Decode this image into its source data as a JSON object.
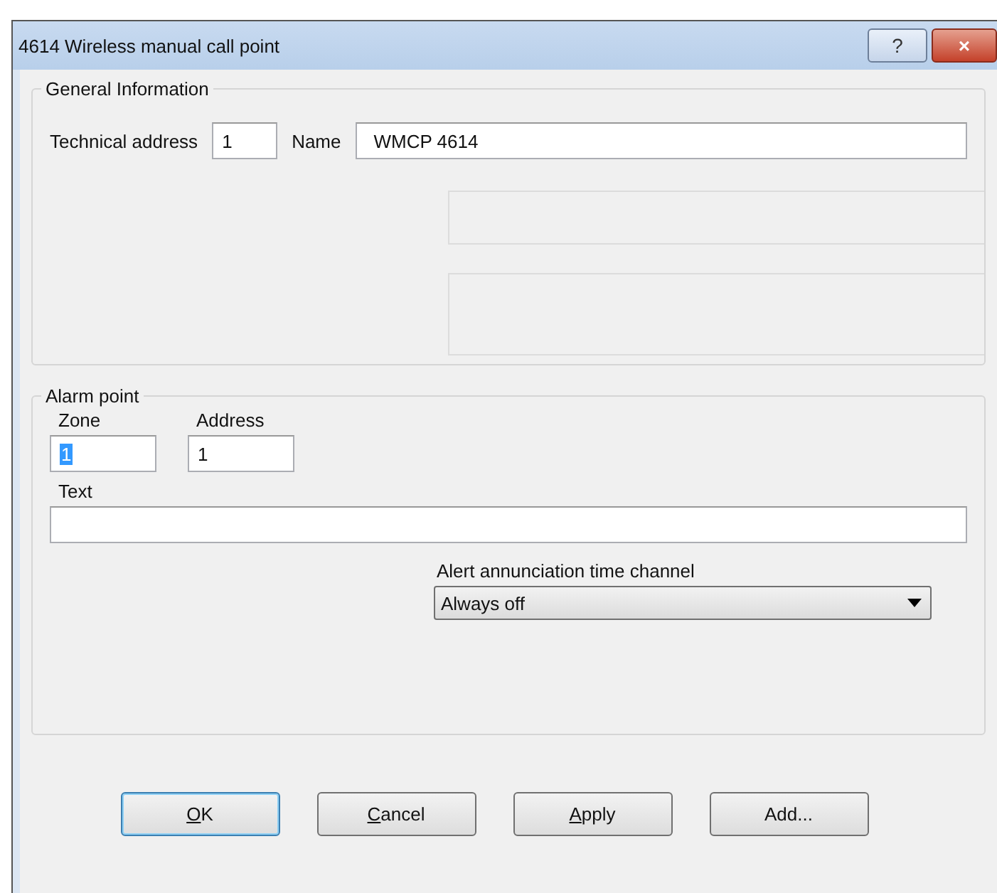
{
  "window": {
    "title": "4614  Wireless manual call point",
    "title_buttons": [
      {
        "kind": "help",
        "label": "?"
      },
      {
        "kind": "close",
        "label": "×"
      }
    ]
  },
  "general_information": {
    "legend": "General Information",
    "technical_address": {
      "label": "Technical address",
      "value": "1"
    },
    "name": {
      "label": "Name",
      "value": "WMCP 4614"
    }
  },
  "alarm_point": {
    "legend": "Alarm point",
    "zone": {
      "label": "Zone",
      "value": "1",
      "text_selected": true
    },
    "address": {
      "label": "Address",
      "value": "1",
      "text_selected": false
    },
    "text": {
      "label": "Text"
    },
    "time_channel": {
      "label": "Alert annunciation time channel",
      "value": "Always off"
    }
  },
  "buttons": [
    {
      "label": "OK",
      "first_letter_underlined": true,
      "default": true
    },
    {
      "label": "Cancel",
      "first_letter_underlined": true,
      "default": false
    },
    {
      "label": "Apply",
      "first_letter_underlined": true,
      "default": false
    },
    {
      "label": "Add...",
      "first_letter_underlined": false,
      "default": false
    }
  ]
}
